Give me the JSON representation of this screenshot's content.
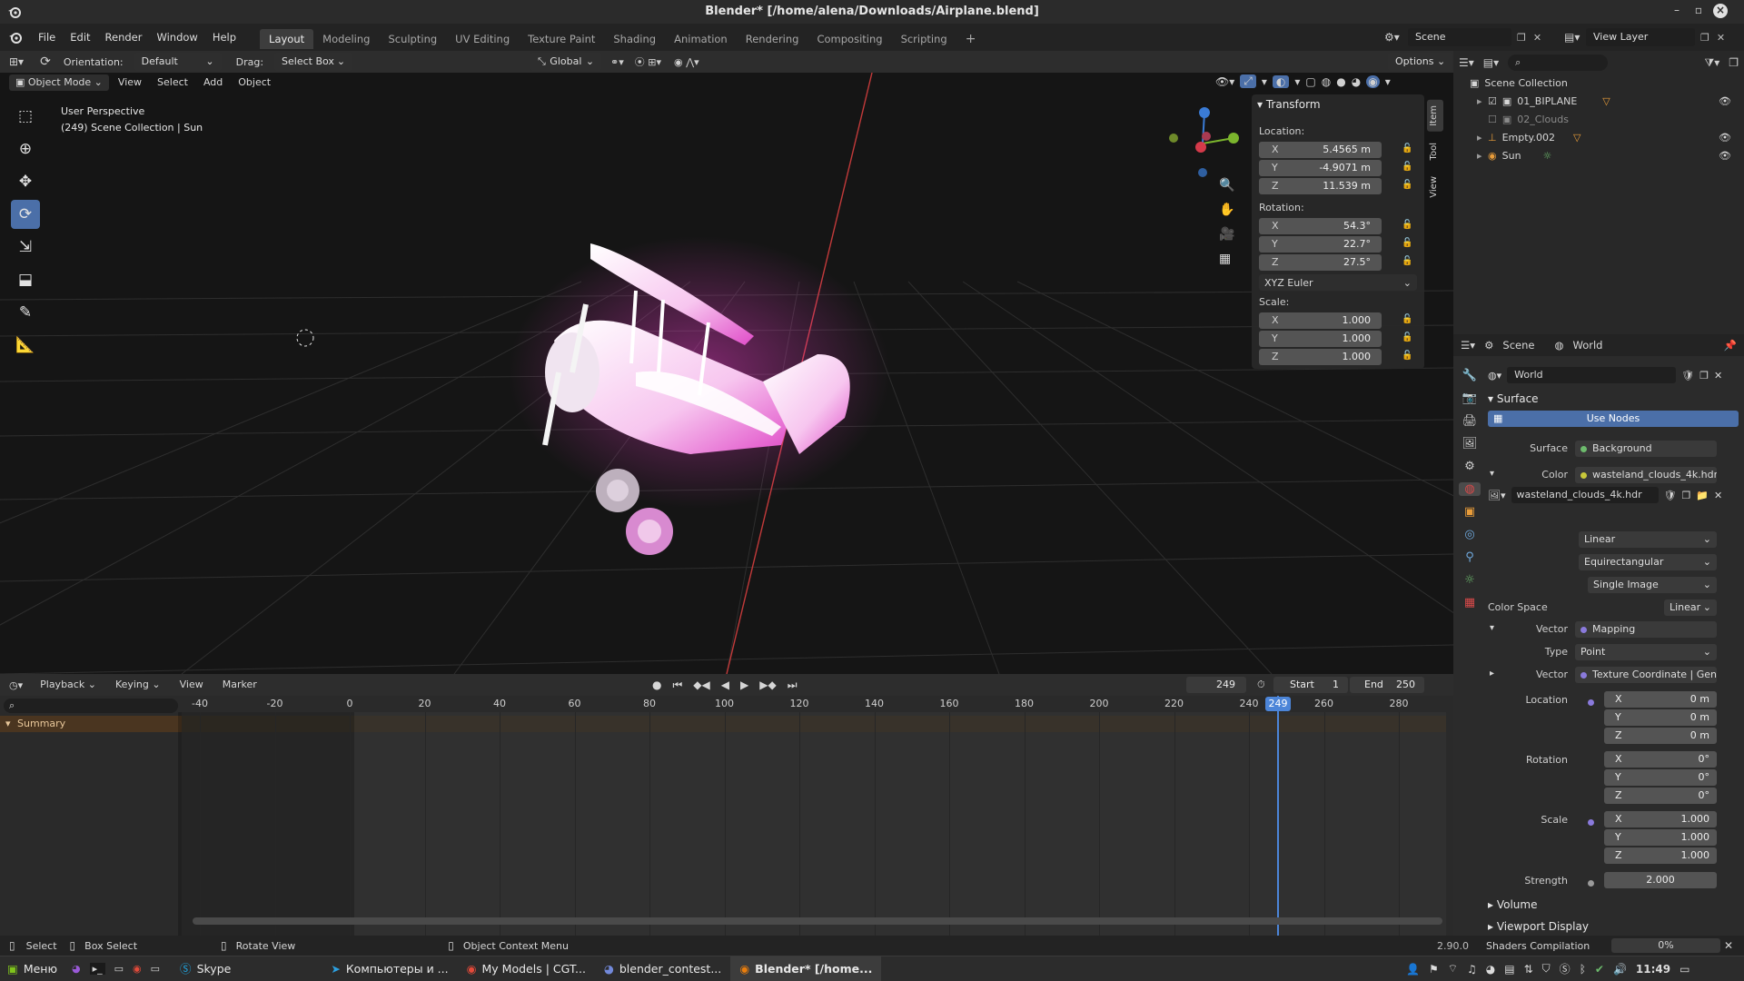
{
  "window": {
    "title": "Blender* [/home/alena/Downloads/Airplane.blend]"
  },
  "menu": {
    "items": [
      "File",
      "Edit",
      "Render",
      "Window",
      "Help"
    ],
    "workspaces": [
      "Layout",
      "Modeling",
      "Sculpting",
      "UV Editing",
      "Texture Paint",
      "Shading",
      "Animation",
      "Rendering",
      "Compositing",
      "Scripting"
    ],
    "active_workspace": "Layout",
    "add_tab": "+",
    "scene": "Scene",
    "view_layer": "View Layer"
  },
  "toolheader": {
    "orientation_label": "Orientation:",
    "orientation_value": "Default",
    "drag_label": "Drag:",
    "drag_value": "Select Box",
    "transform_orientation": "Global",
    "options": "Options"
  },
  "viewport": {
    "mode": "Object Mode",
    "menus": [
      "View",
      "Select",
      "Add",
      "Object"
    ],
    "overlay_line1": "User Perspective",
    "overlay_line2": "(249) Scene Collection | Sun",
    "tabs": [
      "Item",
      "Tool",
      "View"
    ]
  },
  "transform": {
    "title": "Transform",
    "location_label": "Location:",
    "location": {
      "x": "5.4565 m",
      "y": "-4.9071 m",
      "z": "11.539 m"
    },
    "rotation_label": "Rotation:",
    "rotation": {
      "x": "54.3°",
      "y": "22.7°",
      "z": "27.5°"
    },
    "rotation_mode": "XYZ Euler",
    "scale_label": "Scale:",
    "scale": {
      "x": "1.000",
      "y": "1.000",
      "z": "1.000"
    },
    "axis": {
      "x": "X",
      "y": "Y",
      "z": "Z"
    }
  },
  "outliner": {
    "root": "Scene Collection",
    "items": [
      "01_BIPLANE",
      "02_Clouds",
      "Empty.002",
      "Sun"
    ]
  },
  "properties": {
    "header_scene": "Scene",
    "header_world": "World",
    "world_name": "World",
    "surface_section": "Surface",
    "use_nodes": "Use Nodes",
    "surface_label": "Surface",
    "surface_value": "Background",
    "color_label": "Color",
    "color_value": "wasteland_clouds_4k.hdr",
    "image_name": "wasteland_clouds_4k.hdr",
    "interp": "Linear",
    "projection": "Equirectangular",
    "source": "Single Image",
    "color_space_label": "Color Space",
    "color_space_value": "Linear",
    "vector_label": "Vector",
    "vector_value": "Mapping",
    "type_label": "Type",
    "type_value": "Point",
    "vector2_value": "Texture Coordinate | Gen...",
    "location_label": "Location",
    "location": [
      "0 m",
      "0 m",
      "0 m"
    ],
    "rotation_label": "Rotation",
    "rotation": [
      "0°",
      "0°",
      "0°"
    ],
    "scale_label": "Scale",
    "scale": [
      "1.000",
      "1.000",
      "1.000"
    ],
    "strength_label": "Strength",
    "strength_value": "2.000",
    "volume_section": "Volume",
    "viewport_display_section": "Viewport Display"
  },
  "timeline": {
    "menus": [
      "Playback",
      "Keying",
      "View",
      "Marker"
    ],
    "current_frame": "249",
    "start_label": "Start",
    "start_value": "1",
    "end_label": "End",
    "end_value": "250",
    "ticks": [
      "-40",
      "-20",
      "0",
      "20",
      "40",
      "60",
      "80",
      "100",
      "120",
      "140",
      "160",
      "180",
      "200",
      "220",
      "240",
      "260",
      "280"
    ],
    "playhead_label": "249",
    "summary": "Summary"
  },
  "status": {
    "select": "Select",
    "box_select": "Box Select",
    "rotate_view": "Rotate View",
    "context_menu": "Object Context Menu",
    "version": "2.90.0",
    "shaders": "Shaders Compilation",
    "progress": "0%"
  },
  "taskbar": {
    "menu": "Меню",
    "tasks": [
      "Skype",
      "Компьютеры и ...",
      "My Models | CGT...",
      "blender_contest...",
      "Blender* [/home..."
    ],
    "clock": "11:49"
  },
  "colors": {
    "accent": "#4b6fa8",
    "playhead": "#4c85d8",
    "airplane_glow": "#ff3fd8"
  }
}
